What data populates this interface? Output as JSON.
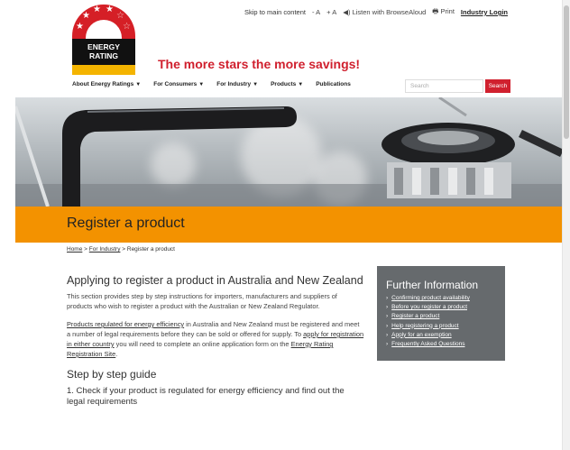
{
  "utility": {
    "skip": "Skip to main content",
    "text_smaller": "- A",
    "text_larger": "+ A",
    "listen": "Listen with BrowseAloud",
    "print": "Print",
    "login": "Industry Login"
  },
  "logo": {
    "line1": "ENERGY",
    "line2": "RATING"
  },
  "tagline": "The more stars the more savings!",
  "nav": [
    {
      "label": "About Energy Ratings"
    },
    {
      "label": "For Consumers"
    },
    {
      "label": "For Industry"
    },
    {
      "label": "Products"
    },
    {
      "label": "Publications"
    }
  ],
  "search": {
    "placeholder": "Search",
    "button": "Search"
  },
  "page_title": "Register a product",
  "breadcrumb": {
    "home": "Home",
    "sep": ">",
    "industry": "For Industry",
    "current": "Register a product"
  },
  "main": {
    "heading": "Applying to register a product in Australia and New Zealand",
    "intro": "This section provides step by step instructions for importers, manufacturers and suppliers of products who wish to register a product with the Australian or New Zealand Regulator.",
    "p2_link1": "Products regulated for energy efficiency",
    "p2_text1": " in Australia and New Zealand must be registered and meet a number of legal requirements before they can be sold or offered for supply. To ",
    "p2_link2": "apply for registration in either country",
    "p2_text2": " you will need to complete an online application form on the ",
    "p2_link3": "Energy Rating Registration Site",
    "p2_text3": ".",
    "guide_heading": "Step by step guide",
    "step1": "1. Check if your product is regulated for energy efficiency and find out the legal requirements"
  },
  "further": {
    "title": "Further Information",
    "links": [
      "Confirming product availability",
      "Before you register a product",
      "Register a product",
      "Help registering a product",
      "Apply for an exemption",
      "Frequently Asked Questions"
    ]
  },
  "colors": {
    "brand_red": "#d0202e",
    "band_orange": "#f39200",
    "panel_grey": "#666a6d"
  }
}
